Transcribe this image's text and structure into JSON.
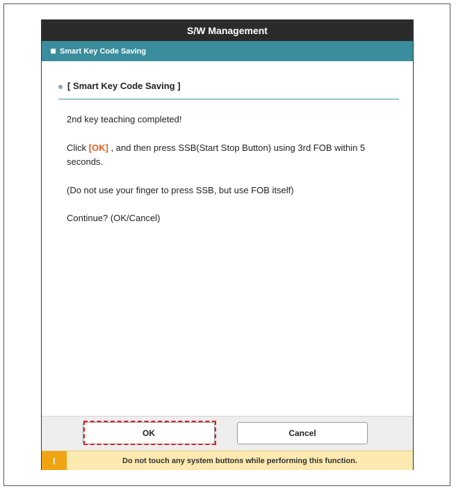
{
  "window": {
    "title": "S/W Management"
  },
  "section": {
    "label": "Smart Key Code Saving"
  },
  "content": {
    "heading": "[ Smart Key Code Saving ]",
    "line1": "2nd key teaching completed!",
    "line2_prefix": "Click ",
    "line2_ok": "[OK]",
    "line2_suffix": " , and then press SSB(Start Stop Button) using 3rd FOB within 5 seconds.",
    "line3": "(Do not use your finger to press SSB, but use FOB itself)",
    "line4": "Continue? (OK/Cancel)"
  },
  "buttons": {
    "ok": "OK",
    "cancel": "Cancel"
  },
  "warning": {
    "icon": "!",
    "text": "Do not touch any system buttons while performing this function."
  },
  "colors": {
    "title_bar": "#2b2b2b",
    "section_bar": "#3a8d9c",
    "ok_highlight": "#e85a1f",
    "warning_bg": "#fbe9b0",
    "warning_icon": "#f0a412",
    "dashed_highlight": "#d42020"
  },
  "icons": {
    "section": "square-icon",
    "heading_bullet": "bullet-icon",
    "warning": "warning-icon"
  }
}
